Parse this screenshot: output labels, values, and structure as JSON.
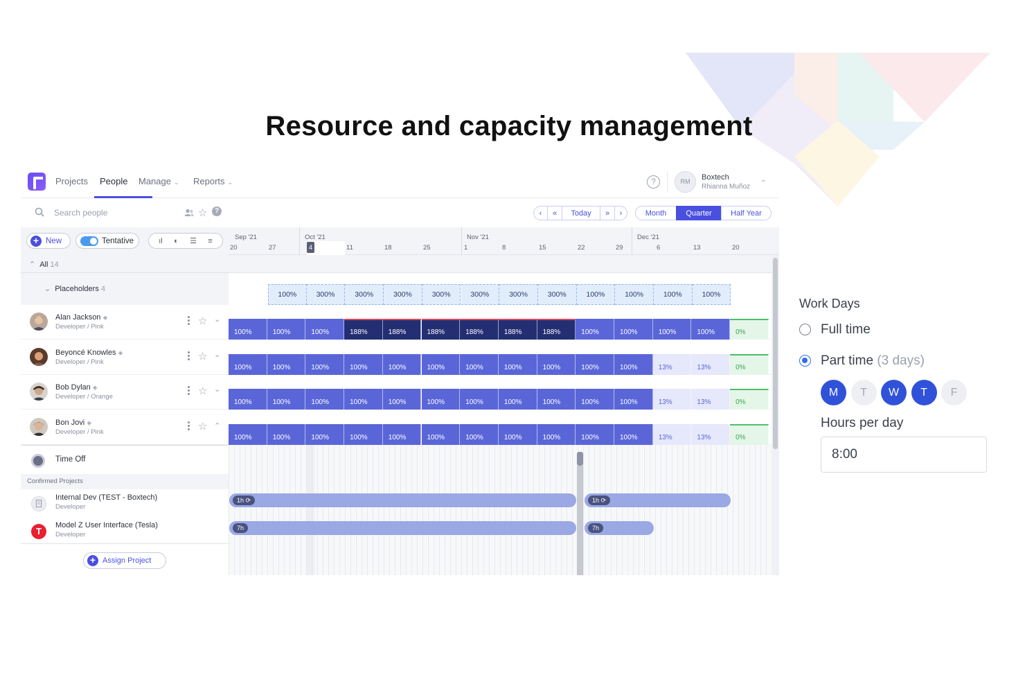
{
  "hero": {
    "title": "Resource and capacity management"
  },
  "nav": {
    "items": [
      {
        "label": "Projects",
        "active": false,
        "dropdown": false
      },
      {
        "label": "People",
        "active": true,
        "dropdown": false
      },
      {
        "label": "Manage",
        "active": false,
        "dropdown": true
      },
      {
        "label": "Reports",
        "active": false,
        "dropdown": true
      }
    ],
    "help": "?",
    "avatar_initials": "RM",
    "org": "Boxtech",
    "user": "Rhianna Muñoz"
  },
  "toolbar": {
    "search_placeholder": "Search people",
    "pager": [
      "‹",
      "«",
      "Today",
      "»",
      "›"
    ],
    "ranges": [
      {
        "label": "Month",
        "active": false
      },
      {
        "label": "Quarter",
        "active": true
      },
      {
        "label": "Half Year",
        "active": false
      }
    ]
  },
  "controls": {
    "new_label": "New",
    "tentative_label": "Tentative"
  },
  "timeline": {
    "months": [
      "Sep '21",
      "Oct '21",
      "Nov '21",
      "Dec '21"
    ],
    "weeks": [
      "20",
      "27",
      "4",
      "11",
      "18",
      "25",
      "1",
      "8",
      "15",
      "22",
      "29",
      "6",
      "13",
      "20"
    ],
    "today_week": "4"
  },
  "groups": {
    "all_label": "All",
    "all_count": "14",
    "placeholders_label": "Placeholders",
    "placeholders_count": "4",
    "placeholder_values": [
      "100%",
      "300%",
      "300%",
      "300%",
      "300%",
      "300%",
      "300%",
      "300%",
      "100%",
      "100%",
      "100%",
      "100%"
    ]
  },
  "people": [
    {
      "name": "Alan Jackson",
      "role": "Developer / Pink",
      "expanded": false,
      "cells": [
        {
          "v": "100%",
          "k": "std"
        },
        {
          "v": "100%",
          "k": "std"
        },
        {
          "v": "100%",
          "k": "std"
        },
        {
          "v": "188%",
          "k": "over"
        },
        {
          "v": "188%",
          "k": "over"
        },
        {
          "v": "188%",
          "k": "over"
        },
        {
          "v": "188%",
          "k": "over"
        },
        {
          "v": "188%",
          "k": "over"
        },
        {
          "v": "188%",
          "k": "over"
        },
        {
          "v": "100%",
          "k": "std"
        },
        {
          "v": "100%",
          "k": "std"
        },
        {
          "v": "100%",
          "k": "std"
        },
        {
          "v": "100%",
          "k": "std"
        },
        {
          "v": "0%",
          "k": "zero"
        }
      ]
    },
    {
      "name": "Beyoncé Knowles",
      "role": "Developer / Pink",
      "expanded": false,
      "cells": [
        {
          "v": "100%",
          "k": "std"
        },
        {
          "v": "100%",
          "k": "std"
        },
        {
          "v": "100%",
          "k": "std"
        },
        {
          "v": "100%",
          "k": "std"
        },
        {
          "v": "100%",
          "k": "std"
        },
        {
          "v": "100%",
          "k": "std"
        },
        {
          "v": "100%",
          "k": "std"
        },
        {
          "v": "100%",
          "k": "std"
        },
        {
          "v": "100%",
          "k": "std"
        },
        {
          "v": "100%",
          "k": "std"
        },
        {
          "v": "100%",
          "k": "std"
        },
        {
          "v": "13%",
          "k": "low"
        },
        {
          "v": "13%",
          "k": "low"
        },
        {
          "v": "0%",
          "k": "zero"
        }
      ]
    },
    {
      "name": "Bob Dylan",
      "role": "Developer / Orange",
      "expanded": false,
      "cells": [
        {
          "v": "100%",
          "k": "std"
        },
        {
          "v": "100%",
          "k": "std"
        },
        {
          "v": "100%",
          "k": "std"
        },
        {
          "v": "100%",
          "k": "std"
        },
        {
          "v": "100%",
          "k": "std"
        },
        {
          "v": "100%",
          "k": "std"
        },
        {
          "v": "100%",
          "k": "std"
        },
        {
          "v": "100%",
          "k": "std"
        },
        {
          "v": "100%",
          "k": "std"
        },
        {
          "v": "100%",
          "k": "std"
        },
        {
          "v": "100%",
          "k": "std"
        },
        {
          "v": "13%",
          "k": "low"
        },
        {
          "v": "13%",
          "k": "low"
        },
        {
          "v": "0%",
          "k": "zero"
        }
      ]
    },
    {
      "name": "Bon Jovi",
      "role": "Developer / Pink",
      "expanded": true,
      "cells": [
        {
          "v": "100%",
          "k": "std"
        },
        {
          "v": "100%",
          "k": "std"
        },
        {
          "v": "100%",
          "k": "std"
        },
        {
          "v": "100%",
          "k": "std"
        },
        {
          "v": "100%",
          "k": "std"
        },
        {
          "v": "100%",
          "k": "std"
        },
        {
          "v": "100%",
          "k": "std"
        },
        {
          "v": "100%",
          "k": "std"
        },
        {
          "v": "100%",
          "k": "std"
        },
        {
          "v": "100%",
          "k": "std"
        },
        {
          "v": "100%",
          "k": "std"
        },
        {
          "v": "13%",
          "k": "low"
        },
        {
          "v": "13%",
          "k": "low"
        },
        {
          "v": "0%",
          "k": "zero"
        }
      ]
    }
  ],
  "timeoff": {
    "label": "Time Off"
  },
  "confirmed": {
    "header": "Confirmed Projects",
    "projects": [
      {
        "name": "Internal Dev (TEST - Boxtech)",
        "role": "Developer",
        "alloc_label": "1h"
      },
      {
        "name": "Model Z User Interface (Tesla)",
        "role": "Developer",
        "alloc_label": "7h"
      }
    ],
    "assign_label": "Assign Project"
  },
  "workdays": {
    "title": "Work Days",
    "full_time_label": "Full time",
    "part_time_label": "Part time",
    "part_time_detail": "(3 days)",
    "selected": "part_time",
    "days": [
      {
        "label": "M",
        "on": true
      },
      {
        "label": "T",
        "on": false
      },
      {
        "label": "W",
        "on": true
      },
      {
        "label": "T",
        "on": true
      },
      {
        "label": "F",
        "on": false
      }
    ],
    "hours_label": "Hours per day",
    "hours_value": "8:00"
  },
  "colors": {
    "accent": "#4a4fe0",
    "standard_alloc": "#5a66d8",
    "over_alloc": "#232e73",
    "over_line": "#e0465a",
    "available": "#4cbe6a",
    "day_on": "#2f52d8"
  }
}
